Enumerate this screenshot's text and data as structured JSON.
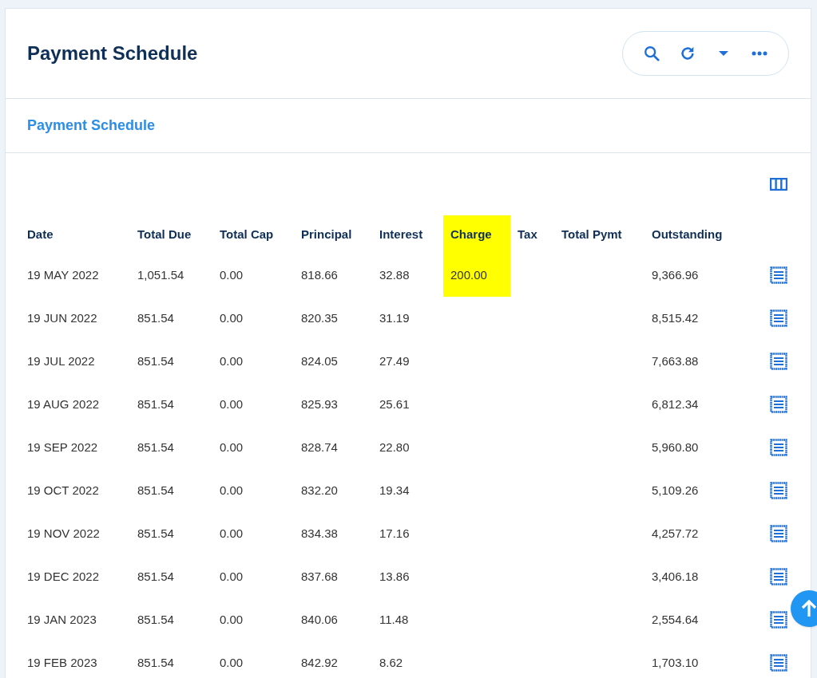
{
  "header": {
    "title": "Payment Schedule"
  },
  "section_tab": {
    "label": "Payment Schedule"
  },
  "table": {
    "columns": [
      {
        "label": "Date",
        "highlighted": false
      },
      {
        "label": "Total Due",
        "highlighted": false
      },
      {
        "label": "Total Cap",
        "highlighted": false
      },
      {
        "label": "Principal",
        "highlighted": false
      },
      {
        "label": "Interest",
        "highlighted": false
      },
      {
        "label": "Charge",
        "highlighted": true
      },
      {
        "label": "Tax",
        "highlighted": false
      },
      {
        "label": "Total Pymt",
        "highlighted": false
      },
      {
        "label": "Outstanding",
        "highlighted": false
      }
    ],
    "rows": [
      {
        "cells": [
          "19 MAY 2022",
          "1,051.54",
          "0.00",
          "818.66",
          "32.88",
          {
            "text": "200.00",
            "highlighted": true
          },
          "",
          "",
          "9,366.96"
        ]
      },
      {
        "cells": [
          "19 JUN 2022",
          "851.54",
          "0.00",
          "820.35",
          "31.19",
          "",
          "",
          "",
          "8,515.42"
        ]
      },
      {
        "cells": [
          "19 JUL 2022",
          "851.54",
          "0.00",
          "824.05",
          "27.49",
          "",
          "",
          "",
          "7,663.88"
        ]
      },
      {
        "cells": [
          "19 AUG 2022",
          "851.54",
          "0.00",
          "825.93",
          "25.61",
          "",
          "",
          "",
          "6,812.34"
        ]
      },
      {
        "cells": [
          "19 SEP 2022",
          "851.54",
          "0.00",
          "828.74",
          "22.80",
          "",
          "",
          "",
          "5,960.80"
        ]
      },
      {
        "cells": [
          "19 OCT 2022",
          "851.54",
          "0.00",
          "832.20",
          "19.34",
          "",
          "",
          "",
          "5,109.26"
        ]
      },
      {
        "cells": [
          "19 NOV 2022",
          "851.54",
          "0.00",
          "834.38",
          "17.16",
          "",
          "",
          "",
          "4,257.72"
        ]
      },
      {
        "cells": [
          "19 DEC 2022",
          "851.54",
          "0.00",
          "837.68",
          "13.86",
          "",
          "",
          "",
          "3,406.18"
        ]
      },
      {
        "cells": [
          "19 JAN 2023",
          "851.54",
          "0.00",
          "840.06",
          "11.48",
          "",
          "",
          "",
          "2,554.64"
        ]
      },
      {
        "cells": [
          "19 FEB 2023",
          "851.54",
          "0.00",
          "842.92",
          "8.62",
          "",
          "",
          "",
          "1,703.10"
        ]
      }
    ]
  }
}
